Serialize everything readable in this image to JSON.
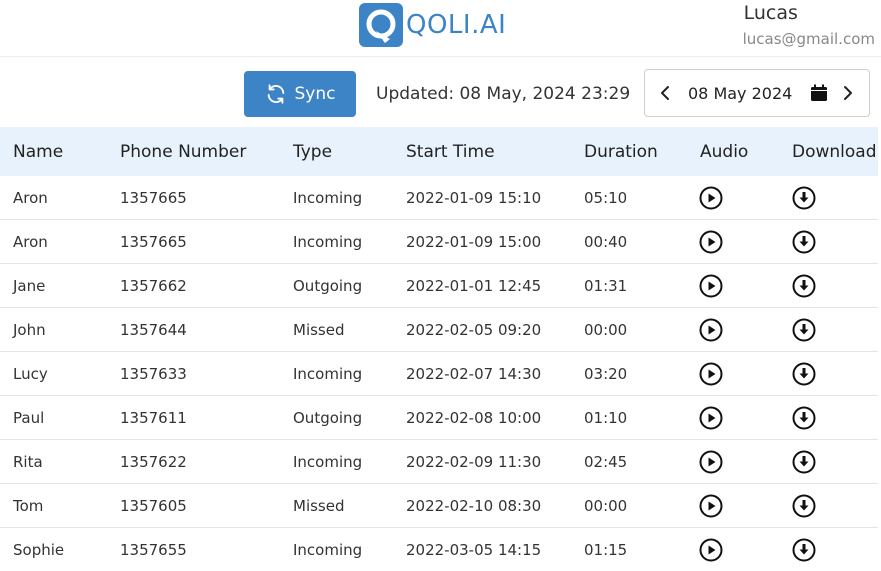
{
  "header": {
    "logo_text": "QOLI.AI",
    "user_name": "Lucas",
    "user_email": "lucas@gmail.com"
  },
  "toolbar": {
    "sync_label": "Sync",
    "updated_text": "Updated: 08 May, 2024 23:29",
    "date_value": "08 May 2024"
  },
  "icons": {
    "sync": "sync-icon",
    "prev": "chevron-left-icon",
    "next": "chevron-right-icon",
    "calendar": "calendar-icon",
    "play": "play-circle-icon",
    "download": "download-circle-icon"
  },
  "colors": {
    "accent": "#3d84c6",
    "header_row_bg": "#e8f2fc"
  },
  "table": {
    "columns": [
      "Name",
      "Phone Number",
      "Type",
      "Start Time",
      "Duration",
      "Audio",
      "Download"
    ],
    "rows": [
      {
        "name": "Aron",
        "phone": "1357665",
        "type": "Incoming",
        "start": "2022-01-09 15:10",
        "duration": "05:10"
      },
      {
        "name": "Aron",
        "phone": "1357665",
        "type": "Incoming",
        "start": "2022-01-09 15:00",
        "duration": "00:40"
      },
      {
        "name": "Jane",
        "phone": "1357662",
        "type": "Outgoing",
        "start": "2022-01-01 12:45",
        "duration": "01:31"
      },
      {
        "name": "John",
        "phone": "1357644",
        "type": "Missed",
        "start": "2022-02-05 09:20",
        "duration": "00:00"
      },
      {
        "name": "Lucy",
        "phone": "1357633",
        "type": "Incoming",
        "start": "2022-02-07 14:30",
        "duration": "03:20"
      },
      {
        "name": "Paul",
        "phone": "1357611",
        "type": "Outgoing",
        "start": "2022-02-08 10:00",
        "duration": "01:10"
      },
      {
        "name": "Rita",
        "phone": "1357622",
        "type": "Incoming",
        "start": "2022-02-09 11:30",
        "duration": "02:45"
      },
      {
        "name": "Tom",
        "phone": "1357605",
        "type": "Missed",
        "start": "2022-02-10 08:30",
        "duration": "00:00"
      },
      {
        "name": "Sophie",
        "phone": "1357655",
        "type": "Incoming",
        "start": "2022-03-05 14:15",
        "duration": "01:15"
      }
    ]
  }
}
